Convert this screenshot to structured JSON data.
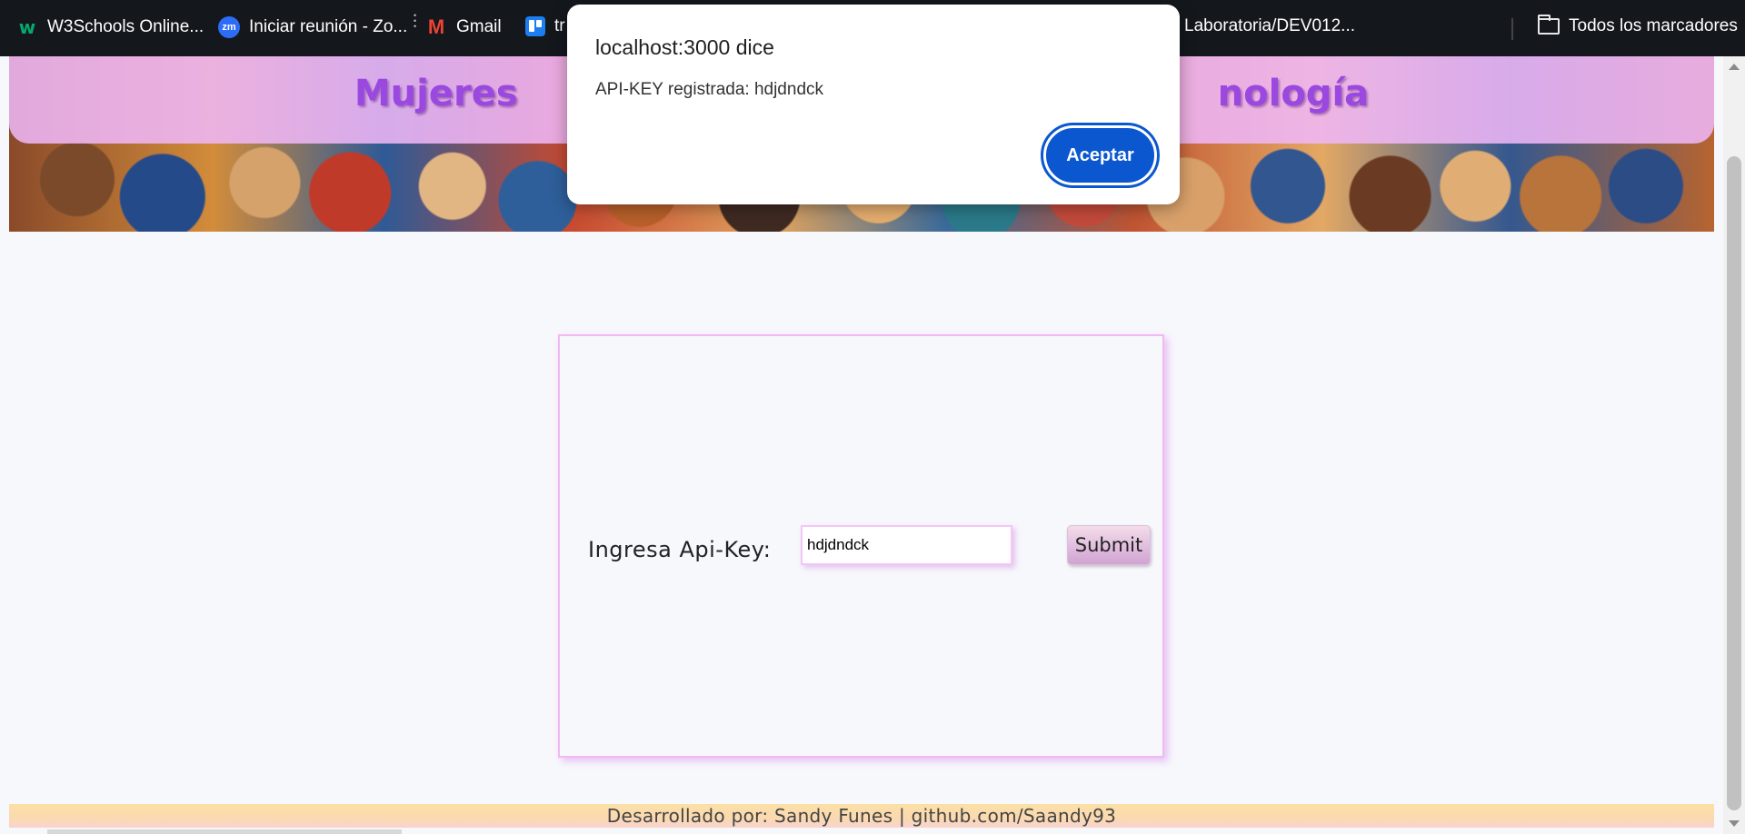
{
  "bookmarks": [
    {
      "label": "W3Schools Online...",
      "icon": "w3schools-icon"
    },
    {
      "label": "Iniciar reunión - Zo...",
      "icon": "zoom-icon"
    },
    {
      "label": "Gmail",
      "icon": "gmail-icon"
    },
    {
      "label": "tr",
      "icon": "trello-icon"
    },
    {
      "label": "Laboratoria/DEV012...",
      "icon": ""
    }
  ],
  "all_bookmarks_label": "Todos los marcadores",
  "banner": {
    "title_left": "Mujeres",
    "title_right": "nología"
  },
  "form": {
    "label": "Ingresa Api-Key:",
    "input_value": "hdjdndck",
    "submit_label": "Submit"
  },
  "footer": {
    "text": "Desarrollado por: Sandy Funes | github.com/Saandy93"
  },
  "dialog": {
    "title": "localhost:3000 dice",
    "message": "API-KEY registrada: hdjdndck",
    "button_label": "Aceptar"
  },
  "colors": {
    "accent_button": "#0b57d0",
    "banner_title": "#9a48e0",
    "card_border": "#f2b8f3",
    "bookmarks_bg": "#14171c"
  }
}
